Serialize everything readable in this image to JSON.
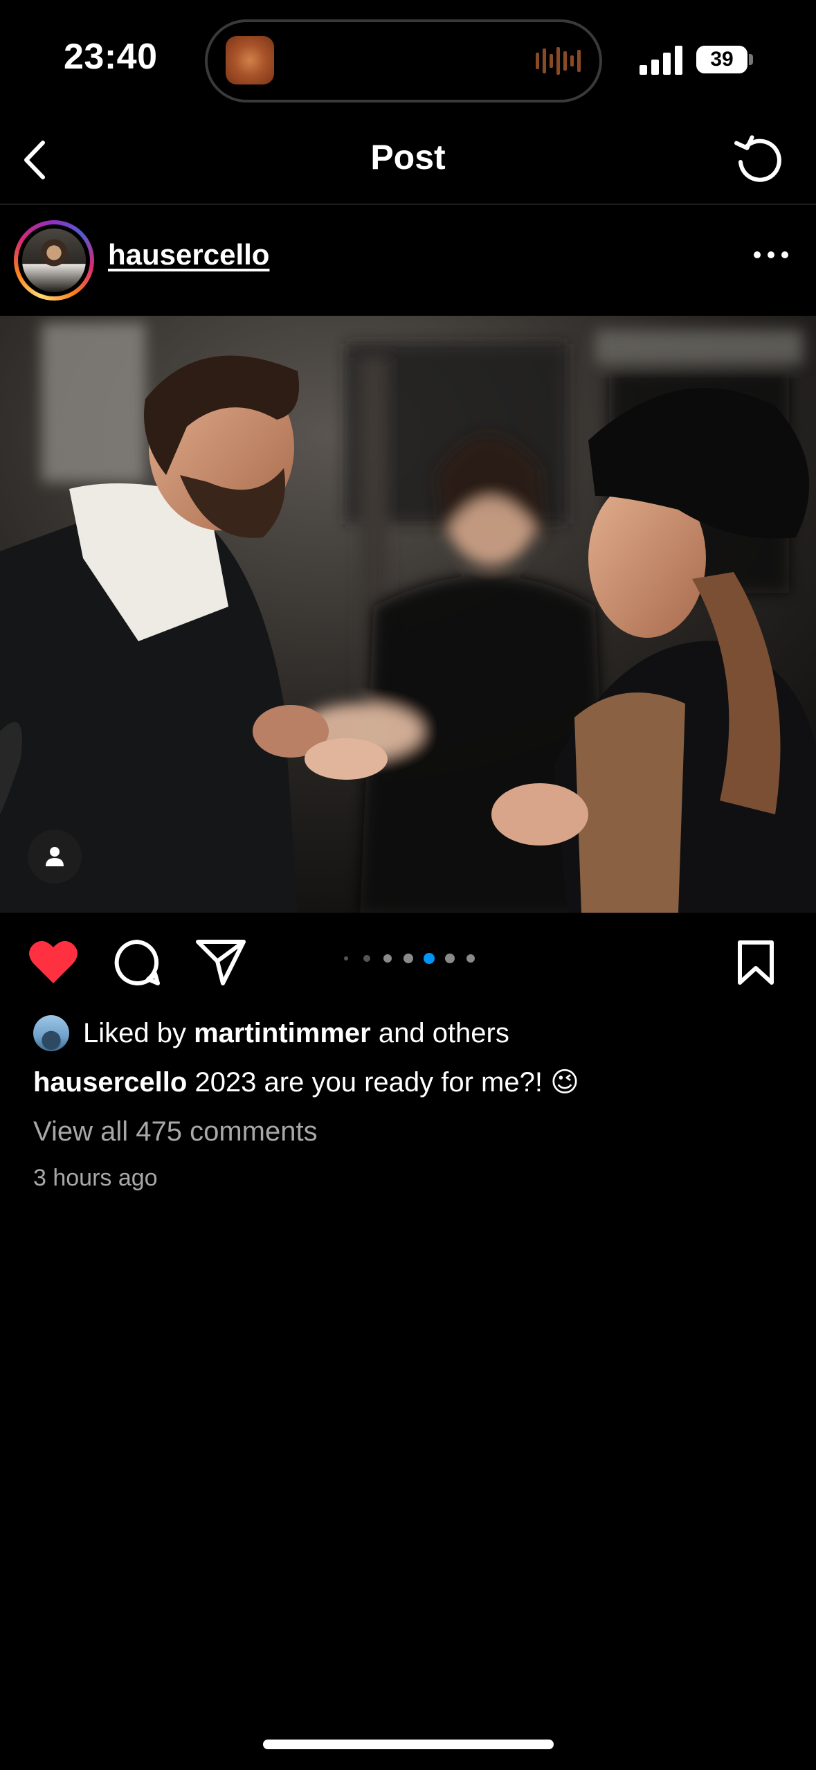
{
  "status_bar": {
    "time": "23:40",
    "battery": "39"
  },
  "nav": {
    "title": "Post",
    "back_icon": "chevron-left-icon",
    "refresh_icon": "refresh-icon"
  },
  "post": {
    "username": "hausercello",
    "caption_user": "hausercello",
    "caption_text": " 2023 are you ready for me?! 😉",
    "liked_by_prefix": "Liked by ",
    "liked_by_user": "martintimmer",
    "liked_by_suffix": " and others",
    "view_comments": "View all 475 comments",
    "time_ago": "3 hours ago",
    "carousel": {
      "count": 7,
      "active_index": 4
    }
  },
  "colors": {
    "heart": "#ff3040",
    "carousel_active": "#0095f6"
  }
}
